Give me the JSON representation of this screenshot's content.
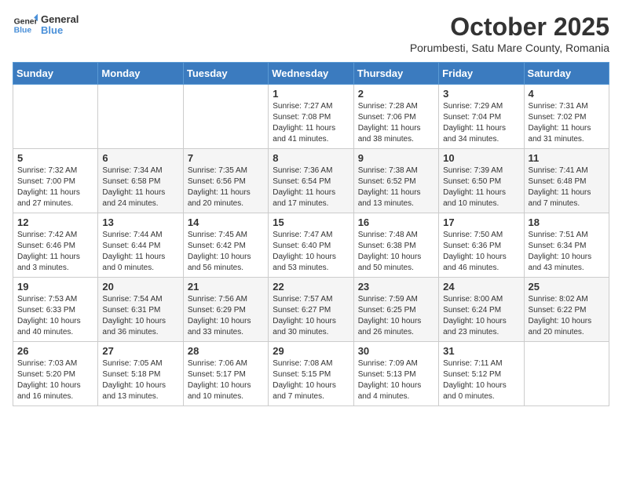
{
  "header": {
    "logo_line1": "General",
    "logo_line2": "Blue",
    "month_title": "October 2025",
    "subtitle": "Porumbesti, Satu Mare County, Romania"
  },
  "weekdays": [
    "Sunday",
    "Monday",
    "Tuesday",
    "Wednesday",
    "Thursday",
    "Friday",
    "Saturday"
  ],
  "weeks": [
    [
      {
        "day": "",
        "info": ""
      },
      {
        "day": "",
        "info": ""
      },
      {
        "day": "",
        "info": ""
      },
      {
        "day": "1",
        "info": "Sunrise: 7:27 AM\nSunset: 7:08 PM\nDaylight: 11 hours\nand 41 minutes."
      },
      {
        "day": "2",
        "info": "Sunrise: 7:28 AM\nSunset: 7:06 PM\nDaylight: 11 hours\nand 38 minutes."
      },
      {
        "day": "3",
        "info": "Sunrise: 7:29 AM\nSunset: 7:04 PM\nDaylight: 11 hours\nand 34 minutes."
      },
      {
        "day": "4",
        "info": "Sunrise: 7:31 AM\nSunset: 7:02 PM\nDaylight: 11 hours\nand 31 minutes."
      }
    ],
    [
      {
        "day": "5",
        "info": "Sunrise: 7:32 AM\nSunset: 7:00 PM\nDaylight: 11 hours\nand 27 minutes."
      },
      {
        "day": "6",
        "info": "Sunrise: 7:34 AM\nSunset: 6:58 PM\nDaylight: 11 hours\nand 24 minutes."
      },
      {
        "day": "7",
        "info": "Sunrise: 7:35 AM\nSunset: 6:56 PM\nDaylight: 11 hours\nand 20 minutes."
      },
      {
        "day": "8",
        "info": "Sunrise: 7:36 AM\nSunset: 6:54 PM\nDaylight: 11 hours\nand 17 minutes."
      },
      {
        "day": "9",
        "info": "Sunrise: 7:38 AM\nSunset: 6:52 PM\nDaylight: 11 hours\nand 13 minutes."
      },
      {
        "day": "10",
        "info": "Sunrise: 7:39 AM\nSunset: 6:50 PM\nDaylight: 11 hours\nand 10 minutes."
      },
      {
        "day": "11",
        "info": "Sunrise: 7:41 AM\nSunset: 6:48 PM\nDaylight: 11 hours\nand 7 minutes."
      }
    ],
    [
      {
        "day": "12",
        "info": "Sunrise: 7:42 AM\nSunset: 6:46 PM\nDaylight: 11 hours\nand 3 minutes."
      },
      {
        "day": "13",
        "info": "Sunrise: 7:44 AM\nSunset: 6:44 PM\nDaylight: 11 hours\nand 0 minutes."
      },
      {
        "day": "14",
        "info": "Sunrise: 7:45 AM\nSunset: 6:42 PM\nDaylight: 10 hours\nand 56 minutes."
      },
      {
        "day": "15",
        "info": "Sunrise: 7:47 AM\nSunset: 6:40 PM\nDaylight: 10 hours\nand 53 minutes."
      },
      {
        "day": "16",
        "info": "Sunrise: 7:48 AM\nSunset: 6:38 PM\nDaylight: 10 hours\nand 50 minutes."
      },
      {
        "day": "17",
        "info": "Sunrise: 7:50 AM\nSunset: 6:36 PM\nDaylight: 10 hours\nand 46 minutes."
      },
      {
        "day": "18",
        "info": "Sunrise: 7:51 AM\nSunset: 6:34 PM\nDaylight: 10 hours\nand 43 minutes."
      }
    ],
    [
      {
        "day": "19",
        "info": "Sunrise: 7:53 AM\nSunset: 6:33 PM\nDaylight: 10 hours\nand 40 minutes."
      },
      {
        "day": "20",
        "info": "Sunrise: 7:54 AM\nSunset: 6:31 PM\nDaylight: 10 hours\nand 36 minutes."
      },
      {
        "day": "21",
        "info": "Sunrise: 7:56 AM\nSunset: 6:29 PM\nDaylight: 10 hours\nand 33 minutes."
      },
      {
        "day": "22",
        "info": "Sunrise: 7:57 AM\nSunset: 6:27 PM\nDaylight: 10 hours\nand 30 minutes."
      },
      {
        "day": "23",
        "info": "Sunrise: 7:59 AM\nSunset: 6:25 PM\nDaylight: 10 hours\nand 26 minutes."
      },
      {
        "day": "24",
        "info": "Sunrise: 8:00 AM\nSunset: 6:24 PM\nDaylight: 10 hours\nand 23 minutes."
      },
      {
        "day": "25",
        "info": "Sunrise: 8:02 AM\nSunset: 6:22 PM\nDaylight: 10 hours\nand 20 minutes."
      }
    ],
    [
      {
        "day": "26",
        "info": "Sunrise: 7:03 AM\nSunset: 5:20 PM\nDaylight: 10 hours\nand 16 minutes."
      },
      {
        "day": "27",
        "info": "Sunrise: 7:05 AM\nSunset: 5:18 PM\nDaylight: 10 hours\nand 13 minutes."
      },
      {
        "day": "28",
        "info": "Sunrise: 7:06 AM\nSunset: 5:17 PM\nDaylight: 10 hours\nand 10 minutes."
      },
      {
        "day": "29",
        "info": "Sunrise: 7:08 AM\nSunset: 5:15 PM\nDaylight: 10 hours\nand 7 minutes."
      },
      {
        "day": "30",
        "info": "Sunrise: 7:09 AM\nSunset: 5:13 PM\nDaylight: 10 hours\nand 4 minutes."
      },
      {
        "day": "31",
        "info": "Sunrise: 7:11 AM\nSunset: 5:12 PM\nDaylight: 10 hours\nand 0 minutes."
      },
      {
        "day": "",
        "info": ""
      }
    ]
  ]
}
